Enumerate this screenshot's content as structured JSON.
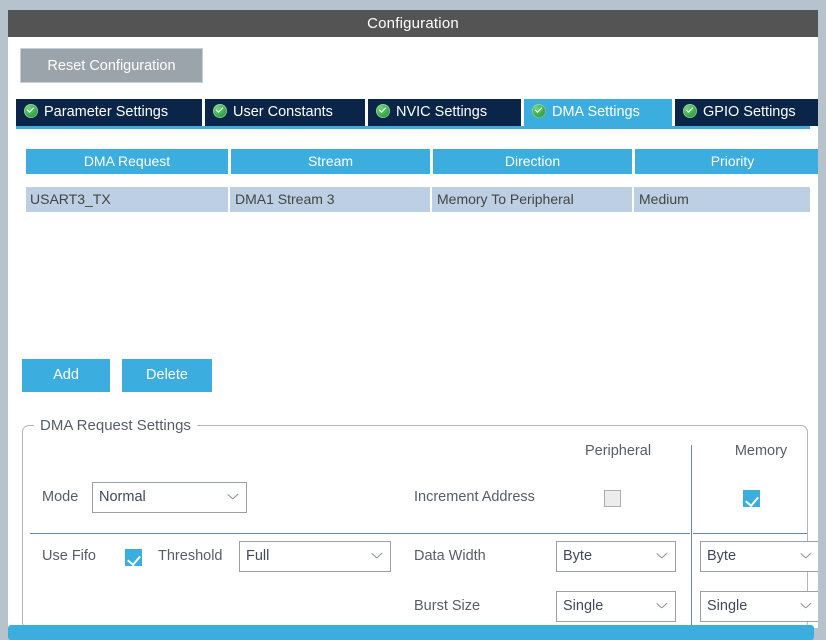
{
  "window": {
    "title": "Configuration"
  },
  "toolbar": {
    "reset_label": "Reset Configuration"
  },
  "tabs": [
    {
      "label": "Parameter Settings",
      "icon": "green-check-icon",
      "active": false
    },
    {
      "label": "User Constants",
      "icon": "green-check-icon",
      "active": false
    },
    {
      "label": "NVIC Settings",
      "icon": "green-check-icon",
      "active": false
    },
    {
      "label": "DMA Settings",
      "icon": "green-check-icon",
      "active": true
    },
    {
      "label": "GPIO Settings",
      "icon": "green-check-icon",
      "active": false
    }
  ],
  "table": {
    "columns": [
      "DMA Request",
      "Stream",
      "Direction",
      "Priority"
    ],
    "rows": [
      {
        "dma_request": "USART3_TX",
        "stream": "DMA1 Stream 3",
        "direction": "Memory To Peripheral",
        "priority": "Medium",
        "selected": true
      }
    ]
  },
  "actions": {
    "add_label": "Add",
    "delete_label": "Delete"
  },
  "settings": {
    "legend": "DMA Request Settings",
    "column_headers": {
      "peripheral": "Peripheral",
      "memory": "Memory"
    },
    "mode": {
      "label": "Mode",
      "value": "Normal"
    },
    "increment_address": {
      "label": "Increment Address",
      "peripheral_checked": false,
      "memory_checked": true
    },
    "use_fifo": {
      "label": "Use Fifo",
      "checked": true
    },
    "threshold": {
      "label": "Threshold",
      "value": "Full"
    },
    "data_width": {
      "label": "Data Width",
      "peripheral_value": "Byte",
      "memory_value": "Byte"
    },
    "burst_size": {
      "label": "Burst Size",
      "peripheral_value": "Single",
      "memory_value": "Single"
    }
  },
  "colors": {
    "accent": "#3badde",
    "tab_inactive": "#0a2547",
    "titlebar": "#545454",
    "row_selected": "#bdd0e3",
    "reset_button": "#9ba3ab"
  }
}
